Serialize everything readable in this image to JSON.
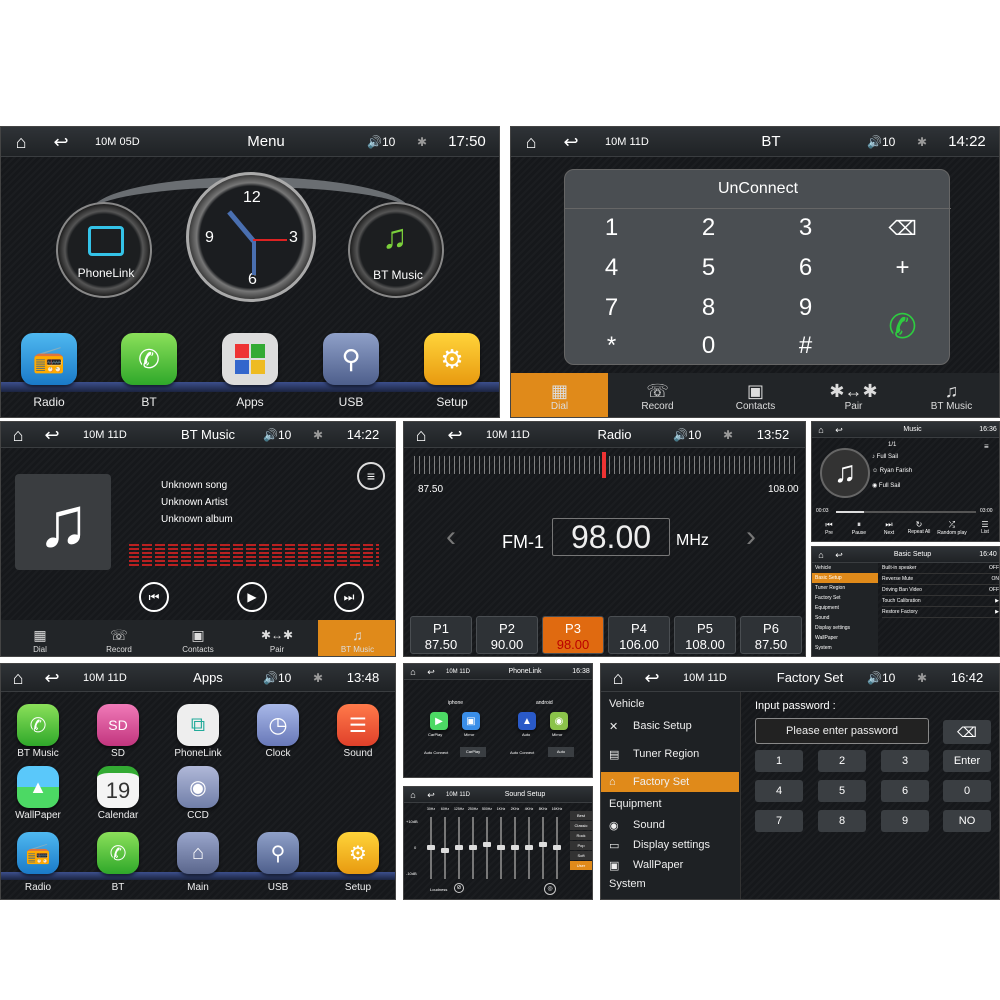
{
  "status_common": {
    "home_glyph": "⌂",
    "back_glyph": "↩",
    "volume": "🔊10",
    "bt_glyph": "✱"
  },
  "menu": {
    "date": "10M 05D",
    "title": "Menu",
    "time": "17:50",
    "phonelink": "PhoneLink",
    "btmusic": "BT Music",
    "clock": {
      "n12": "12",
      "n3": "3",
      "n6": "6",
      "n9": "9"
    },
    "dock": [
      "Radio",
      "BT",
      "Apps",
      "USB",
      "Setup"
    ]
  },
  "bt": {
    "date": "10M 11D",
    "title": "BT",
    "time": "14:22",
    "status": "UnConnect",
    "keys": [
      "1",
      "2",
      "3",
      "4",
      "5",
      "6",
      "7",
      "8",
      "9",
      "*",
      "0",
      "#"
    ],
    "plus": "+",
    "tabs": [
      "Dial",
      "Record",
      "Contacts",
      "Pair",
      "BT Music"
    ]
  },
  "btmusic": {
    "date": "10M 11D",
    "title": "BT Music",
    "time": "14:22",
    "song": "Unknown song",
    "artist": "Unknown Artist",
    "album": "Unknown album",
    "tabs": [
      "Dial",
      "Record",
      "Contacts",
      "Pair",
      "BT Music"
    ]
  },
  "radio": {
    "date": "10M 11D",
    "title": "Radio",
    "time": "13:52",
    "min": "87.50",
    "max": "108.00",
    "band": "FM-1",
    "freq": "98.00",
    "unit": "MHz",
    "presets": [
      {
        "name": "P1",
        "value": "87.50"
      },
      {
        "name": "P2",
        "value": "90.00"
      },
      {
        "name": "P3",
        "value": "98.00"
      },
      {
        "name": "P4",
        "value": "106.00"
      },
      {
        "name": "P5",
        "value": "108.00"
      },
      {
        "name": "P6",
        "value": "87.50"
      }
    ]
  },
  "music_small": {
    "title": "Music",
    "time": "16:36",
    "count": "1/1",
    "song": "Full Sail",
    "artist": "Ryan Farish",
    "album": "Full Sail",
    "t_start": "00:03",
    "t_end": "03:00",
    "controls": [
      "Pre",
      "Pause",
      "Next",
      "Repeat All",
      "Random play",
      "List"
    ]
  },
  "basic_small": {
    "title": "Basic Setup",
    "time": "16:40",
    "menu": [
      "Vehicle",
      "Basic Setup",
      "Tuner Region",
      "Factory Set",
      "Equipment",
      "Sound",
      "Display settings",
      "WallPaper",
      "System"
    ],
    "rows": [
      {
        "k": "Built-in speaker",
        "v": "OFF"
      },
      {
        "k": "Reverse Mute",
        "v": "ON"
      },
      {
        "k": "Driving Ban Video",
        "v": "OFF"
      },
      {
        "k": "Touch Calibration",
        "v": "▶"
      },
      {
        "k": "Restore Factory",
        "v": "▶"
      }
    ]
  },
  "apps": {
    "date": "10M 11D",
    "title": "Apps",
    "time": "13:48",
    "row1": [
      "BT Music",
      "SD",
      "PhoneLink",
      "Clock",
      "Sound"
    ],
    "row2": [
      "WallPaper",
      "Calendar",
      "CCD"
    ],
    "cal_day": "19",
    "row3": [
      "Radio",
      "BT",
      "Main",
      "USB",
      "Setup"
    ]
  },
  "phonelink": {
    "date": "10M 11D",
    "title": "PhoneLink",
    "time": "16:38",
    "left_head": "iphone",
    "right_head": "android",
    "left_items": [
      "CarPlay",
      "Mirror"
    ],
    "right_items": [
      "Auto",
      "Mirror"
    ],
    "auto_connect": "Auto Connect",
    "left_btn": "CarPlay",
    "right_btn": "Auto"
  },
  "sound": {
    "date": "10M 11D",
    "title": "Sound Setup",
    "time": "",
    "top": "+10dB",
    "mid": "0",
    "bot": "-10dB",
    "freqs": [
      "30Hz",
      "60Hz",
      "125Hz",
      "250Hz",
      "500Hz",
      "1KHz",
      "2KHz",
      "4KHz",
      "8KHz",
      "16KHz"
    ],
    "eq_levels": [
      0.5,
      0.45,
      0.5,
      0.5,
      0.55,
      0.5,
      0.5,
      0.5,
      0.55,
      0.5
    ],
    "presets": [
      "Best",
      "Classic",
      "Rock",
      "Pop",
      "Soft",
      "User"
    ],
    "loudness": "Loudness"
  },
  "factory": {
    "date": "10M 11D",
    "title": "Factory Set",
    "time": "16:42",
    "menu": {
      "vehicle": "Vehicle",
      "basic": "Basic Setup",
      "tuner": "Tuner Region",
      "factory": "Factory Set",
      "equipment": "Equipment",
      "sound": "Sound",
      "display": "Display settings",
      "wallpaper": "WallPaper",
      "system": "System"
    },
    "input_label": "Input password :",
    "placeholder": "Please enter password",
    "keys": [
      "1",
      "2",
      "3",
      "Enter",
      "4",
      "5",
      "6",
      "0",
      "7",
      "8",
      "9",
      "NO"
    ]
  },
  "colors": {
    "accent": "#e08a1a",
    "green": "#2ecc40",
    "bg": "#16181b"
  }
}
